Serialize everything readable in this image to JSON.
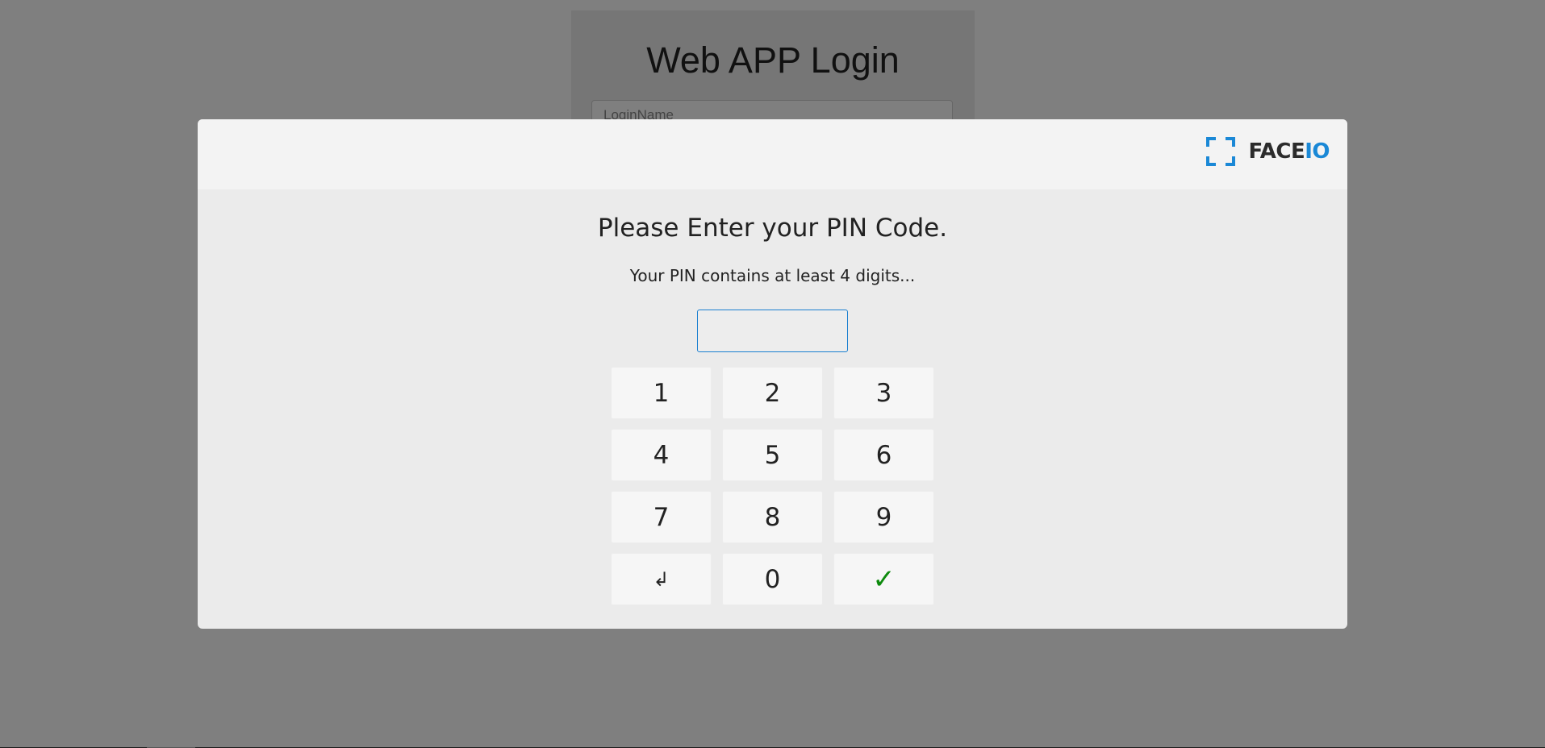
{
  "background": {
    "title": "Web APP Login",
    "login_placeholder": "LoginName"
  },
  "modal": {
    "logo": {
      "face": "FACE",
      "io": "IO"
    },
    "heading": "Please Enter your PIN Code.",
    "subtitle": "Your PIN contains at least 4 digits...",
    "pin_value": "",
    "keys": {
      "k1": "1",
      "k2": "2",
      "k3": "3",
      "k4": "4",
      "k5": "5",
      "k6": "6",
      "k7": "7",
      "k8": "8",
      "k9": "9",
      "back": "↲",
      "k0": "0",
      "confirm": "✓"
    }
  },
  "colors": {
    "accent": "#1a88d6",
    "confirm": "#0d8a0d",
    "overlay": "#808080"
  }
}
